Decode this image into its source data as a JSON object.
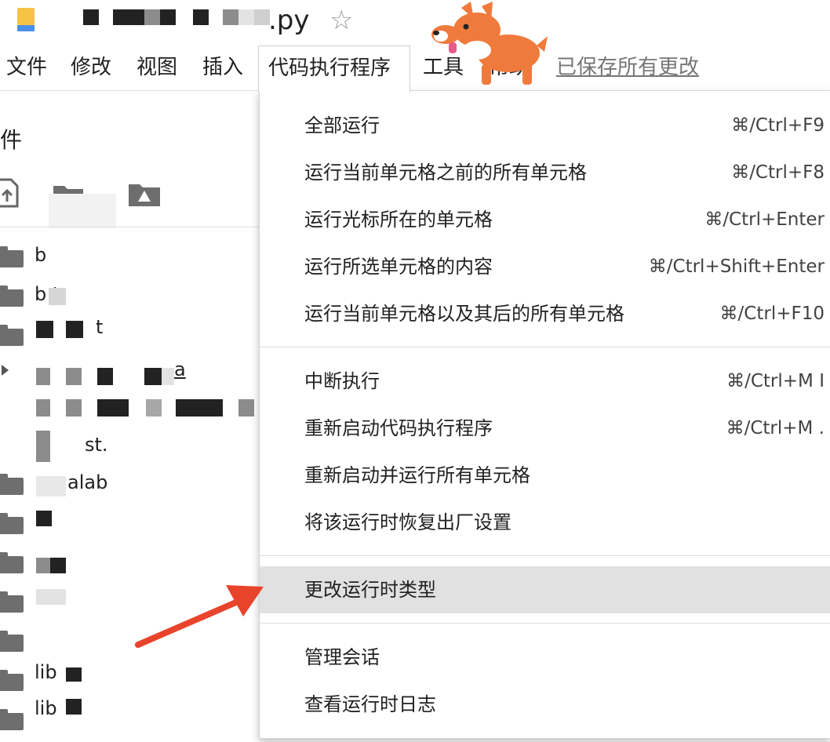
{
  "title": {
    "suffix": ".py",
    "star": "☆"
  },
  "menubar": {
    "items": [
      "文件",
      "修改",
      "视图",
      "插入",
      "代码执行程序",
      "工具",
      "帮助"
    ],
    "active_item": "代码执行程序",
    "saved_status": "已保存所有更改"
  },
  "sidebar": {
    "title": "件",
    "files": [
      {
        "label": "b"
      },
      {
        "label": "b  t"
      },
      {
        "label": "t"
      },
      {
        "label": "a"
      },
      {
        "label": "st."
      },
      {
        "label": "alab"
      },
      {
        "label": ""
      },
      {
        "label": ""
      },
      {
        "label": ""
      },
      {
        "label": ""
      },
      {
        "label": "lib"
      },
      {
        "label": "lib"
      }
    ]
  },
  "dropdown": {
    "groups": [
      [
        {
          "label": "全部运行",
          "shortcut": "⌘/Ctrl+F9"
        },
        {
          "label": "运行当前单元格之前的所有单元格",
          "shortcut": "⌘/Ctrl+F8"
        },
        {
          "label": "运行光标所在的单元格",
          "shortcut": "⌘/Ctrl+Enter"
        },
        {
          "label": "运行所选单元格的内容",
          "shortcut": "⌘/Ctrl+Shift+Enter"
        },
        {
          "label": "运行当前单元格以及其后的所有单元格",
          "shortcut": "⌘/Ctrl+F10"
        }
      ],
      [
        {
          "label": "中断执行",
          "shortcut": "⌘/Ctrl+M I"
        },
        {
          "label": "重新启动代码执行程序",
          "shortcut": "⌘/Ctrl+M ."
        },
        {
          "label": "重新启动并运行所有单元格",
          "shortcut": ""
        },
        {
          "label": "将该运行时恢复出厂设置",
          "shortcut": ""
        }
      ],
      [
        {
          "label": "更改运行时类型",
          "shortcut": "",
          "highlighted": true
        }
      ],
      [
        {
          "label": "管理会话",
          "shortcut": ""
        },
        {
          "label": "查看运行时日志",
          "shortcut": ""
        }
      ]
    ]
  },
  "colors": {
    "highlight": "#e1e1e1",
    "arrow": "#e8442c",
    "corgi": "#f07a3c",
    "folder": "#6e6e6e"
  },
  "icons": {
    "upload": "upload-icon",
    "mount_drive": "mount-drive-icon",
    "google_drive": "google-drive-icon",
    "star": "star-icon"
  }
}
